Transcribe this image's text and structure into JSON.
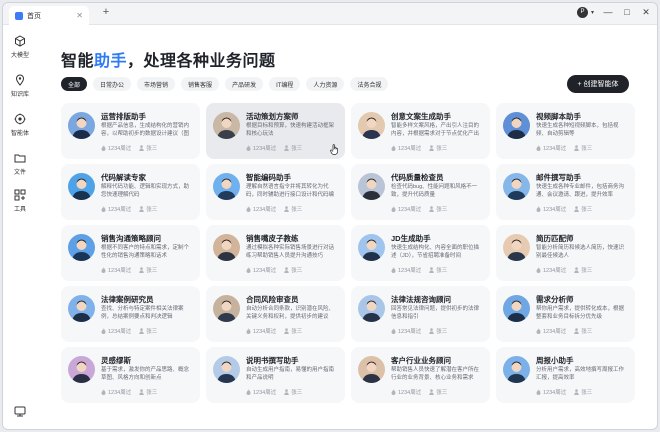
{
  "window": {
    "tab_title": "首页",
    "new_tab_symbol": "+",
    "account_letter": "P",
    "controls": {
      "minimize": "—",
      "maximize": "□",
      "close": "✕"
    }
  },
  "sidebar": {
    "items": [
      {
        "label": "大模型",
        "icon": "cube-icon"
      },
      {
        "label": "知识库",
        "icon": "location-pin-icon"
      },
      {
        "label": "智能体",
        "icon": "agent-gear-icon"
      },
      {
        "label": "文件",
        "icon": "folder-icon"
      },
      {
        "label": "工具",
        "icon": "tools-grid-icon"
      }
    ],
    "bottom_icon": "feedback-icon"
  },
  "heading": {
    "prefix": "智能",
    "accent": "助手",
    "suffix": "，处理各种业务问题"
  },
  "filters": [
    "全部",
    "日常办公",
    "市场营销",
    "销售客服",
    "产品研发",
    "IT编程",
    "人力资源",
    "法务合规"
  ],
  "create_button": "+ 创建智能体",
  "accent_color": "#2f7bf6",
  "cards": [
    {
      "title": "运营排版助手",
      "desc": "根据产品信息，生成结构化的营销内容，以帮助初步的数据设计建议（图片）",
      "uses": "1234周过",
      "author": "张三"
    },
    {
      "title": "活动策划方案师",
      "desc": "根据目标和预算，快速构建活动框架和核心玩法",
      "uses": "1234周过",
      "author": "张三"
    },
    {
      "title": "创意文案生成助手",
      "desc": "智能多样文案风格，产出引人注目的内容，并根据需求对于节点优化产出",
      "uses": "1234周过",
      "author": "张三"
    },
    {
      "title": "视频脚本助手",
      "desc": "快速生成各种短视频脚本，包括视频、自动剪辑等",
      "uses": "1234周过",
      "author": "张三"
    },
    {
      "title": "代码解读专家",
      "desc": "解释代码功能、逻辑和实现方式，助您快速理解代码",
      "uses": "1234周过",
      "author": "张三"
    },
    {
      "title": "智能编码助手",
      "desc": "理解自然语言指令并将其转化为代码，同时辅助进行接口设计和代码编写",
      "uses": "1234周过",
      "author": "张三"
    },
    {
      "title": "代码质量检查员",
      "desc": "检查代码bug、性能问题和风格不一致，提升代码质量",
      "uses": "1234周过",
      "author": "张三"
    },
    {
      "title": "邮件撰写助手",
      "desc": "快速生成各种专业邮件，包括商务沟通、会议邀请、跟进，提升效率",
      "uses": "1234周过",
      "author": "张三"
    },
    {
      "title": "销售沟通策略顾问",
      "desc": "根据不同客户的特点和需求，定制个性化的销售沟通策略和话术",
      "uses": "1234周过",
      "author": "张三"
    },
    {
      "title": "销售嘴皮子教练",
      "desc": "通过模拟各种实际销售场景进行对话练习帮助销售人员提升沟通技巧",
      "uses": "1234周过",
      "author": "张三"
    },
    {
      "title": "JD生成助手",
      "desc": "快速生成结构化、内容全面的职位描述（JD），节省招聘准备时间",
      "uses": "1234周过",
      "author": "张三"
    },
    {
      "title": "简历匹配师",
      "desc": "智能分析简历和候选人简历，快速识别最佳候选人",
      "uses": "1234周过",
      "author": "张三"
    },
    {
      "title": "法律案例研究员",
      "desc": "查找、分析与特定案件相关法律案例，总结案例要点和判决逻辑",
      "uses": "1234周过",
      "author": "张三"
    },
    {
      "title": "合同风险审查员",
      "desc": "自动分析合同条款，识别潜在风险、关键义务和权利，提供初步的建议",
      "uses": "1234周过",
      "author": "张三"
    },
    {
      "title": "法律法规咨询顾问",
      "desc": "回答常见法律问题，提供初步的法律信息和指引",
      "uses": "1234周过",
      "author": "张三"
    },
    {
      "title": "需求分析师",
      "desc": "帮你用户需求，提供转化成本，根据整套和业务目标拆分优先级",
      "uses": "1234周过",
      "author": "张三"
    },
    {
      "title": "灵感缪斯",
      "desc": "基于需求，激发你的产品思路、概念草图、风格方向和创新点",
      "uses": "1234周过",
      "author": "张三"
    },
    {
      "title": "说明书撰写助手",
      "desc": "自动生成用户指南，易懂的用户指南和产品说明",
      "uses": "1234周过",
      "author": "张三"
    },
    {
      "title": "客户行业业务顾问",
      "desc": "帮助销售人员快速了解潜在客户所在行业的业务背景、核心业务和需求",
      "uses": "1234周过",
      "author": "张三"
    },
    {
      "title": "周报小助手",
      "desc": "分析用户需求，高效地撰写周报工作汇报，提高效率",
      "uses": "1234周过",
      "author": "张三"
    }
  ]
}
